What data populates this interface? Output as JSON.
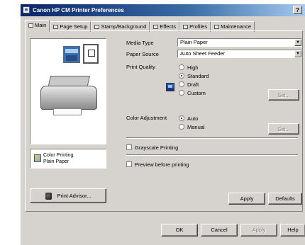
{
  "window": {
    "title": "Canon HP CM Printer Preferences",
    "help_label": "?"
  },
  "tabs": [
    {
      "label": "Main"
    },
    {
      "label": "Page Setup"
    },
    {
      "label": "Stamp/Background"
    },
    {
      "label": "Effects"
    },
    {
      "label": "Profiles"
    },
    {
      "label": "Maintenance"
    }
  ],
  "main": {
    "media_box": {
      "line1": "Color Printing",
      "line2": "Plain Paper"
    },
    "presets_label": "Print Advisor...",
    "media_type": {
      "label": "Media Type",
      "value": "Plain Paper"
    },
    "paper_source": {
      "label": "Paper Source",
      "value": "Auto Sheet Feeder"
    },
    "print_quality": {
      "label": "Print Quality",
      "options": [
        "High",
        "Standard",
        "Draft",
        "Custom"
      ],
      "selected": "Standard",
      "set_label": "Set..."
    },
    "color_adjustment": {
      "label": "Color Adjustment",
      "options": [
        "Auto",
        "Manual"
      ],
      "selected": "Auto",
      "set_label": "Set..."
    },
    "grayscale_label": "Grayscale Printing",
    "preview_label": "Preview before printing"
  },
  "buttons": {
    "apply_inner": "Apply",
    "defaults": "Defaults",
    "ok": "OK",
    "cancel": "Cancel",
    "apply": "Apply",
    "help": "Help"
  }
}
